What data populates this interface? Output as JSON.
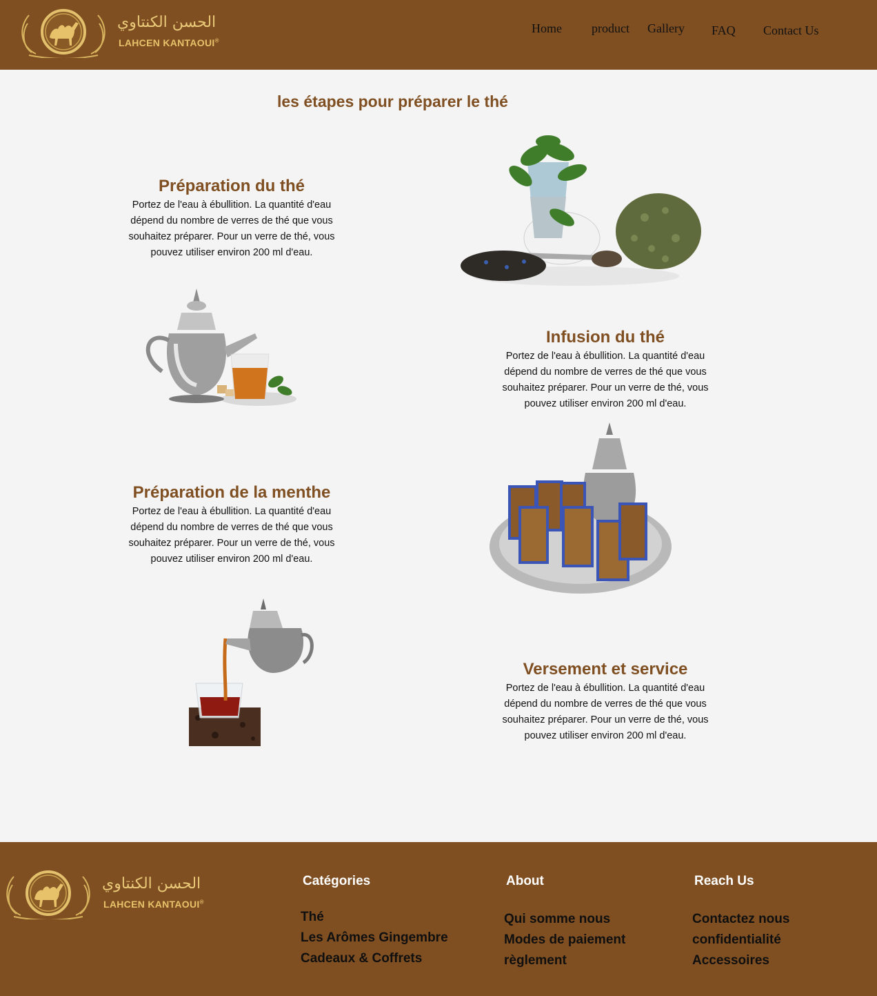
{
  "header": {
    "logo": {
      "arabic": "الحسن الكنتاوي",
      "latin": "LAHCEN KANTAOUI",
      "reg_mark": "®"
    },
    "nav": [
      "Home",
      "product",
      "Gallery",
      "FAQ",
      "Contact Us"
    ]
  },
  "main": {
    "title": "les étapes pour préparer le thé",
    "steps": [
      {
        "title": "Préparation du thé",
        "text": "Portez de l'eau à ébullition. La quantité d'eau dépend du nombre de verres de thé que vous souhaitez préparer. Pour un verre de thé, vous pouvez utiliser environ 200 ml d'eau."
      },
      {
        "title": "Infusion du thé",
        "text": "Portez de l'eau à ébullition. La quantité d'eau dépend du nombre de verres de thé que vous souhaitez préparer. Pour un verre de thé, vous pouvez utiliser environ 200 ml d'eau."
      },
      {
        "title": "Préparation de la menthe",
        "text": "Portez de l'eau à ébullition. La quantité d'eau dépend du nombre de verres de thé que vous souhaitez préparer. Pour un verre de thé, vous pouvez utiliser environ 200 ml d'eau."
      },
      {
        "title": "Versement et service",
        "text": "Portez de l'eau à ébullition. La quantité d'eau dépend du nombre de verres de thé que vous souhaitez préparer. Pour un verre de thé, vous pouvez utiliser environ 200 ml d'eau."
      }
    ]
  },
  "footer": {
    "logo": {
      "arabic": "الحسن الكنتاوي",
      "latin": "LAHCEN KANTAOUI",
      "reg_mark": "®"
    },
    "columns": [
      {
        "heading": "Catégories",
        "items": [
          "Thé",
          "Les Arômes Gingembre",
          "Cadeaux & Coffrets"
        ]
      },
      {
        "heading": "About",
        "items": [
          "Qui somme nous",
          "Modes de paiement",
          "règlement"
        ]
      },
      {
        "heading": "Reach Us",
        "items": [
          "Contactez nous",
          "confidentialité",
          "Accessoires"
        ]
      }
    ]
  },
  "colors": {
    "brand_brown": "#7f4f22",
    "gold": "#e7c26a",
    "background": "#f4f4f4"
  }
}
